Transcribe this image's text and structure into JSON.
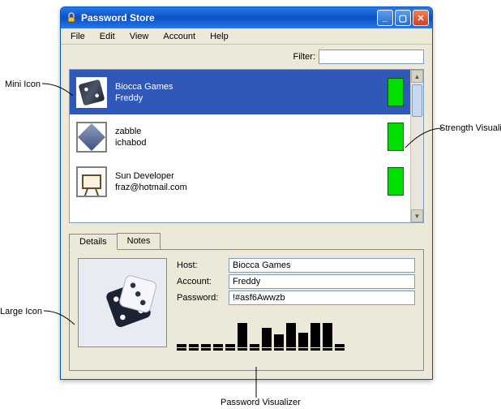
{
  "window": {
    "title": "Password Store"
  },
  "menu": [
    "File",
    "Edit",
    "View",
    "Account",
    "Help"
  ],
  "filter": {
    "label": "Filter:",
    "value": ""
  },
  "accounts": [
    {
      "host": "Biocca Games",
      "user": "Freddy",
      "icon": "dice"
    },
    {
      "host": "zabble",
      "user": "ichabod",
      "icon": "diamond"
    },
    {
      "host": "Sun Developer",
      "user": "fraz@hotmail.com",
      "icon": "easel"
    }
  ],
  "tabs": {
    "details": "Details",
    "notes": "Notes"
  },
  "details": {
    "host_label": "Host:",
    "host": "Biocca Games",
    "account_label": "Account:",
    "account": "Freddy",
    "password_label": "Password:",
    "password": "!#asf6Awwzb"
  },
  "pwviz_heights": [
    4,
    4,
    4,
    4,
    4,
    30,
    4,
    24,
    16,
    30,
    18,
    30,
    30,
    4
  ],
  "annotations": {
    "mini_icon": "Mini Icon",
    "strength": "Strength Visualizer",
    "large_icon": "Large Icon",
    "pwviz": "Password Visualizer"
  }
}
